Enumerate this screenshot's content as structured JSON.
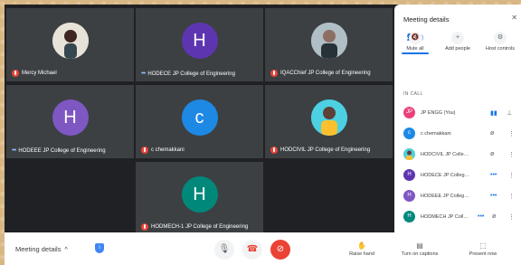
{
  "tiles": [
    {
      "name": "Mercy Michael",
      "status": "muted",
      "type": "photo"
    },
    {
      "name": "HODECE JP College of Engineering",
      "status": "speaking",
      "initial": "H",
      "color": "#5e35b1"
    },
    {
      "name": "IQACChief JP College of Engineering",
      "status": "muted",
      "type": "photo"
    },
    {
      "name": "HODEEE JP College of Engineering",
      "status": "speaking",
      "initial": "H",
      "color": "#7e57c2"
    },
    {
      "name": "c chemakkani",
      "status": "muted",
      "initial": "c",
      "color": "#1e88e5"
    },
    {
      "name": "HODCIVIL JP College of Engineering",
      "status": "muted",
      "type": "photo"
    },
    {
      "name": "HODMECH-1 JP College of Engineering",
      "status": "muted",
      "initial": "H",
      "color": "#00897b"
    }
  ],
  "panel": {
    "title": "Meeting details",
    "close": "✕",
    "tab_people_count": "(8)",
    "actions": [
      {
        "icon": "🔇",
        "label": "Mute all"
      },
      {
        "icon": "+",
        "label": "Add people"
      },
      {
        "icon": "⚙",
        "label": "Host controls"
      }
    ],
    "section_label": "IN CALL",
    "participants": [
      {
        "initial": "JP",
        "name": "JP ENGG (You)",
        "color": "#ec407a"
      },
      {
        "initial": "c",
        "name": "c chemakkani",
        "color": "#1e88e5"
      },
      {
        "initial": "",
        "name": "HODCIVIL JP College of...",
        "color": "#f9a825"
      },
      {
        "initial": "H",
        "name": "HODECE JP College of...",
        "color": "#5e35b1"
      },
      {
        "initial": "H",
        "name": "HODEEE JP College of...",
        "color": "#7e57c2"
      },
      {
        "initial": "H",
        "name": "HODMECH JP College...",
        "color": "#00897b"
      }
    ]
  },
  "bottom_bar": {
    "meeting_details": "Meeting details",
    "chevron": "^",
    "tools": [
      {
        "icon": "✋",
        "label": "Raise hand"
      },
      {
        "icon": "▤",
        "label": "Turn on captions"
      },
      {
        "icon": "⬚",
        "label": "Present now"
      }
    ]
  }
}
